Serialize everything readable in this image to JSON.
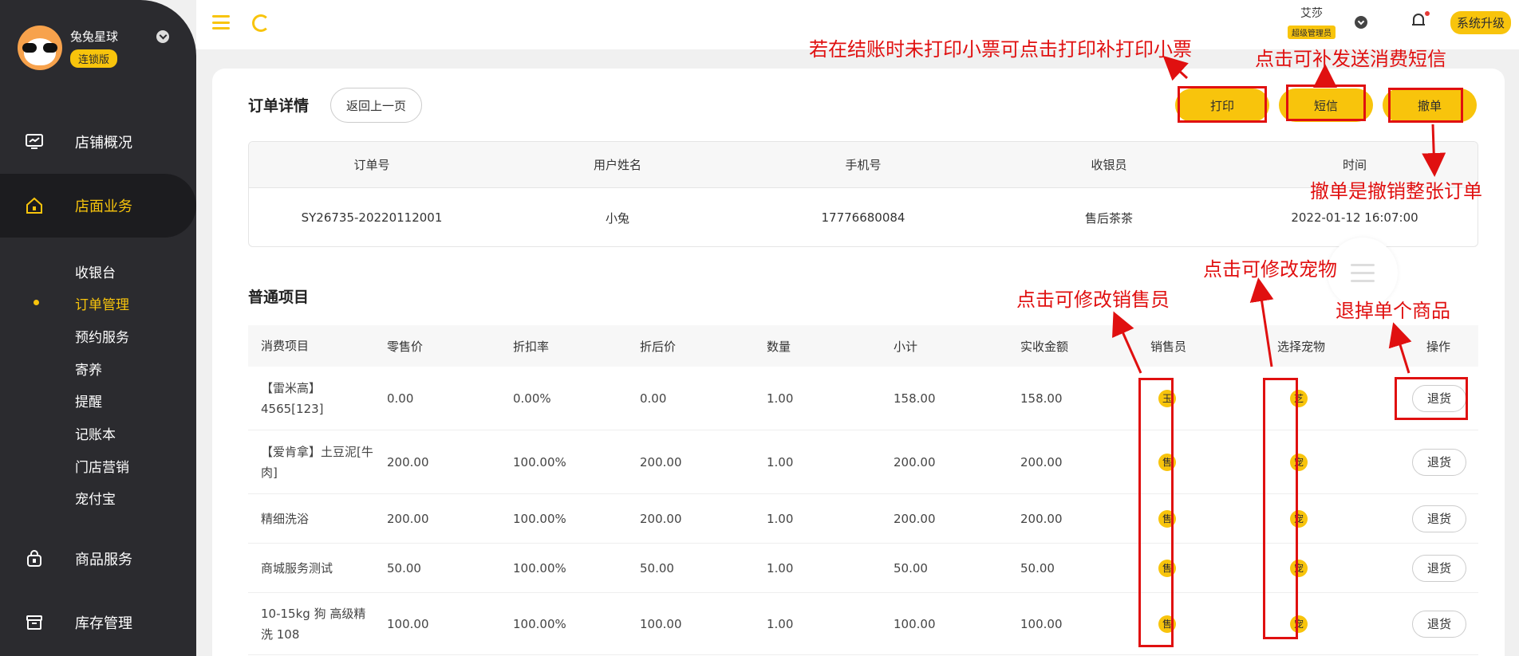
{
  "brand": {
    "name": "兔兔星球",
    "badge": "连锁版"
  },
  "nav": {
    "main": [
      {
        "label": "店铺概况",
        "icon": "monitor-icon"
      },
      {
        "label": "店面业务",
        "icon": "home-icon"
      },
      {
        "label": "商品服务",
        "icon": "bag-icon"
      },
      {
        "label": "库存管理",
        "icon": "box-icon"
      }
    ],
    "sub": [
      "收银台",
      "订单管理",
      "预约服务",
      "寄养",
      "提醒",
      "记账本",
      "门店营销",
      "宠付宝"
    ]
  },
  "header": {
    "user_name": "艾莎",
    "user_role": "超级管理员",
    "upgrade": "系统升级"
  },
  "page": {
    "title": "订单详情",
    "back": "返回上一页",
    "print": "打印",
    "sms": "短信",
    "revoke": "撤单",
    "section_title": "普通项目"
  },
  "order_info": {
    "headers": [
      "订单号",
      "用户姓名",
      "手机号",
      "收银员",
      "时间"
    ],
    "values": [
      "SY26735-20220112001",
      "小兔",
      "17776680084",
      "售后茶茶",
      "2022-01-12 16:07:00"
    ]
  },
  "items": {
    "headers": [
      "消费项目",
      "零售价",
      "折扣率",
      "折后价",
      "数量",
      "小计",
      "实收金额",
      "销售员",
      "选择宠物",
      "操作"
    ],
    "rows": [
      {
        "name": "【雷米高】4565[123]",
        "price": "0.00",
        "rate": "0.00%",
        "disc": "0.00",
        "qty": "1.00",
        "sub": "158.00",
        "paid": "158.00",
        "seller": "玉",
        "pet": "芝",
        "action": "退货"
      },
      {
        "name": "【爱肯拿】土豆泥[牛肉]",
        "price": "200.00",
        "rate": "100.00%",
        "disc": "200.00",
        "qty": "1.00",
        "sub": "200.00",
        "paid": "200.00",
        "seller": "售",
        "pet": "宠",
        "action": "退货"
      },
      {
        "name": "精细洗浴",
        "price": "200.00",
        "rate": "100.00%",
        "disc": "200.00",
        "qty": "1.00",
        "sub": "200.00",
        "paid": "200.00",
        "seller": "售",
        "pet": "宠",
        "action": "退货"
      },
      {
        "name": "商城服务测试",
        "price": "50.00",
        "rate": "100.00%",
        "disc": "50.00",
        "qty": "1.00",
        "sub": "50.00",
        "paid": "50.00",
        "seller": "售",
        "pet": "宠",
        "action": "退货"
      },
      {
        "name": "10-15kg 狗 高级精洗 108",
        "price": "100.00",
        "rate": "100.00%",
        "disc": "100.00",
        "qty": "1.00",
        "sub": "100.00",
        "paid": "100.00",
        "seller": "售",
        "pet": "宠",
        "action": "退货"
      }
    ]
  },
  "annotations": {
    "print_note": "若在结账时未打印小票可点击打印补打印小票",
    "sms_note": "点击可补发送消费短信",
    "revoke_note": "撤单是撤销整张订单",
    "seller_note": "点击可修改销售员",
    "pet_note": "点击可修改宠物",
    "return_note": "退掉单个商品"
  },
  "colors": {
    "accent": "#f8c40c",
    "sidebar": "#2b2b2f",
    "annotation": "#e01010"
  }
}
